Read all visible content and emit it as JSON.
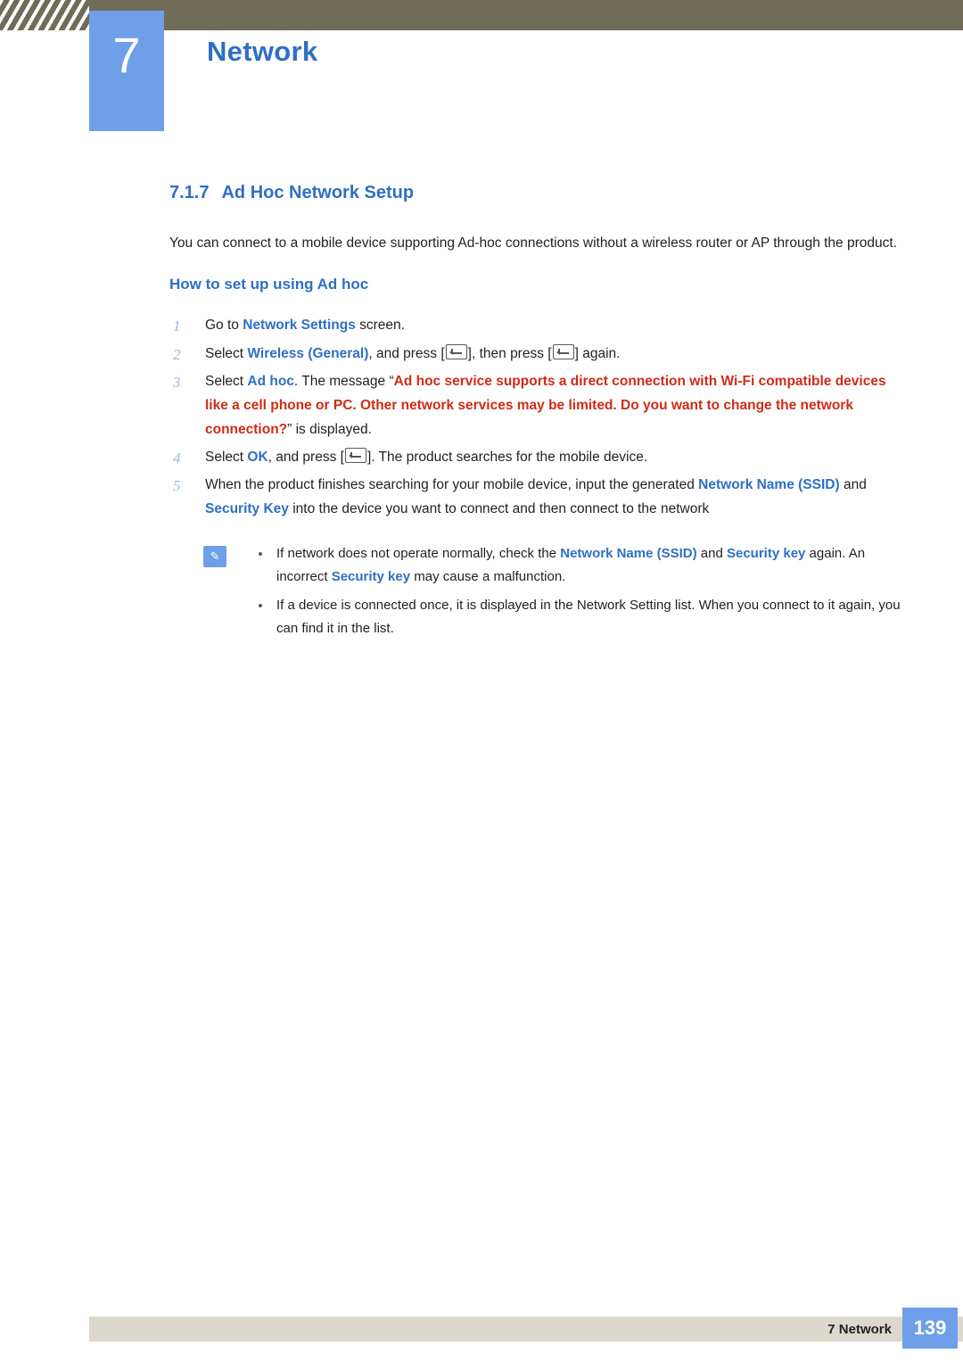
{
  "header": {
    "chapter_number": "7",
    "chapter_title": "Network"
  },
  "section": {
    "number": "7.1.7",
    "title": "Ad Hoc Network Setup",
    "intro": "You can connect to a mobile device supporting Ad-hoc connections without a wireless router or AP through the product.",
    "sub_heading": "How to set up using Ad hoc"
  },
  "steps": [
    {
      "index": "1",
      "parts": [
        {
          "t": "Go to ",
          "s": "plain"
        },
        {
          "t": "Network Settings",
          "s": "blue"
        },
        {
          "t": " screen.",
          "s": "plain"
        }
      ]
    },
    {
      "index": "2",
      "parts": [
        {
          "t": "Select ",
          "s": "plain"
        },
        {
          "t": "Wireless (General)",
          "s": "blue"
        },
        {
          "t": ", and press [",
          "s": "plain"
        },
        {
          "t": "",
          "s": "key"
        },
        {
          "t": "], then press [",
          "s": "plain"
        },
        {
          "t": "",
          "s": "key"
        },
        {
          "t": "] again.",
          "s": "plain"
        }
      ]
    },
    {
      "index": "3",
      "parts": [
        {
          "t": "Select ",
          "s": "plain"
        },
        {
          "t": "Ad hoc",
          "s": "blue"
        },
        {
          "t": ". The message “",
          "s": "plain"
        },
        {
          "t": "Ad hoc service supports a direct connection with Wi-Fi compatible devices like a cell phone or PC. Other network services may be limited. Do you want to change the network connection?",
          "s": "red"
        },
        {
          "t": "” is displayed.",
          "s": "plain"
        }
      ]
    },
    {
      "index": "4",
      "parts": [
        {
          "t": "Select ",
          "s": "plain"
        },
        {
          "t": "OK",
          "s": "blue"
        },
        {
          "t": ", and press [",
          "s": "plain"
        },
        {
          "t": "",
          "s": "key"
        },
        {
          "t": "]. The product searches for the mobile device.",
          "s": "plain"
        }
      ]
    },
    {
      "index": "5",
      "parts": [
        {
          "t": "When the product finishes searching for your mobile device, input the generated ",
          "s": "plain"
        },
        {
          "t": "Network Name (SSID)",
          "s": "blue"
        },
        {
          "t": " and ",
          "s": "plain"
        },
        {
          "t": "Security Key",
          "s": "blue"
        },
        {
          "t": " into the device you want to connect and then connect to the network",
          "s": "plain"
        }
      ]
    }
  ],
  "note": {
    "icon_glyph": "✎",
    "items": [
      {
        "parts": [
          {
            "t": "If network does not operate normally, check the ",
            "s": "plain"
          },
          {
            "t": "Network Name (SSID)",
            "s": "blue"
          },
          {
            "t": " and ",
            "s": "plain"
          },
          {
            "t": "Security key",
            "s": "blue"
          },
          {
            "t": " again. An incorrect ",
            "s": "plain"
          },
          {
            "t": "Security key",
            "s": "blue"
          },
          {
            "t": " may cause a malfunction.",
            "s": "plain"
          }
        ]
      },
      {
        "parts": [
          {
            "t": "If a device is connected once, it is displayed in the Network Setting list. When you connect to it again, you can find it in the list.",
            "s": "plain"
          }
        ]
      }
    ]
  },
  "footer": {
    "label": "7 Network",
    "page_number": "139"
  },
  "colors": {
    "header_bar": "#6f6c58",
    "accent_blue": "#2f6fc4",
    "chapter_box": "#6f9fe8",
    "red": "#cf2b18",
    "footer_bar": "#ddd8cd"
  }
}
